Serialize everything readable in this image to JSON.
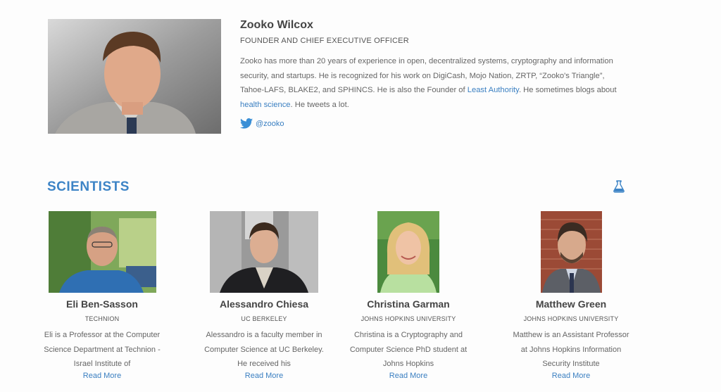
{
  "founder": {
    "name": "Zooko Wilcox",
    "title": "FOUNDER AND CHIEF EXECUTIVE OFFICER",
    "bio_part1": "Zooko has more than 20 years of experience in open, decentralized systems, cryptography and information security, and startups. He is recognized for his work on DigiCash, Mojo Nation, ZRTP, “Zooko's Triangle”, Tahoe-LAFS, BLAKE2, and SPHINCS. He is also the Founder of ",
    "bio_link1": "Least Authority",
    "bio_part2": ". He sometimes blogs about ",
    "bio_link2": "health science",
    "bio_part3": ". He tweets a lot.",
    "twitter_handle": "@zooko"
  },
  "scientists_section": {
    "heading": "SCIENTISTS"
  },
  "scientists": [
    {
      "name": "Eli Ben-Sasson",
      "affiliation": "TECHNION",
      "bio": "Eli is a Professor at the Computer Science Department at Technion - Israel Institute of",
      "read_more": "Read More"
    },
    {
      "name": "Alessandro Chiesa",
      "affiliation": "UC BERKELEY",
      "bio": "Alessandro is a faculty member in Computer Science at UC Berkeley. He received his",
      "read_more": "Read More"
    },
    {
      "name": "Christina Garman",
      "affiliation": "JOHNS HOPKINS UNIVERSITY",
      "bio": "Christina is a Cryptography and Computer Science PhD student at Johns Hopkins",
      "read_more": "Read More"
    },
    {
      "name": "Matthew Green",
      "affiliation": "JOHNS HOPKINS UNIVERSITY",
      "bio": "Matthew is an Assistant Professor at Johns Hopkins Information Security Institute",
      "read_more": "Read More"
    }
  ],
  "colors": {
    "accent": "#3d84c6",
    "link": "#3a7fc1",
    "heading_text": "#444444",
    "body_text": "#666666"
  },
  "icons": {
    "twitter": "twitter-icon",
    "section": "flask-icon"
  }
}
